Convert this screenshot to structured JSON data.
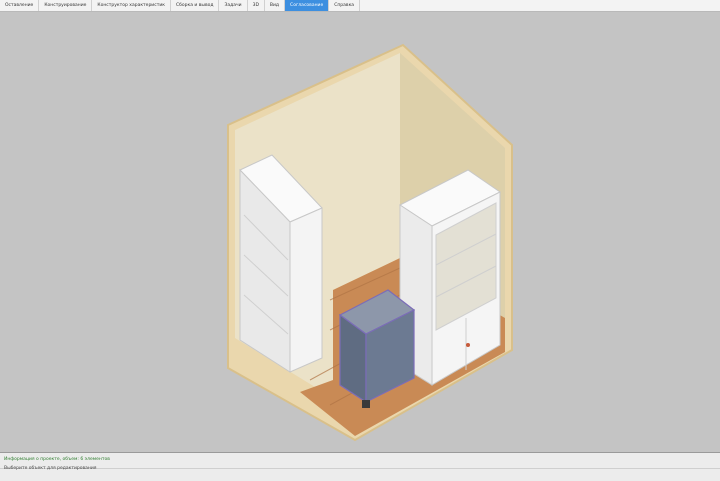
{
  "menubar": {
    "items": [
      {
        "label": "Оставление"
      },
      {
        "label": "Конструирование"
      },
      {
        "label": "Конструктор характеристик"
      },
      {
        "label": "Сборка и вывод"
      },
      {
        "label": "Задачи"
      },
      {
        "label": "3D"
      },
      {
        "label": "Вид"
      },
      {
        "label": "Согласование",
        "active": true
      },
      {
        "label": "Справка"
      }
    ]
  },
  "status": {
    "line1": "Информация о проекте, объем: 6 элементов",
    "line2": "Выберите объект для редактирования"
  },
  "colors": {
    "accent": "#3d8fe0",
    "viewport": "#c4c4c4",
    "wall": "#e6dcc1",
    "floor": "#c98a55",
    "cabinet": "#f1f1f1",
    "selected_box": "#6a7890"
  }
}
